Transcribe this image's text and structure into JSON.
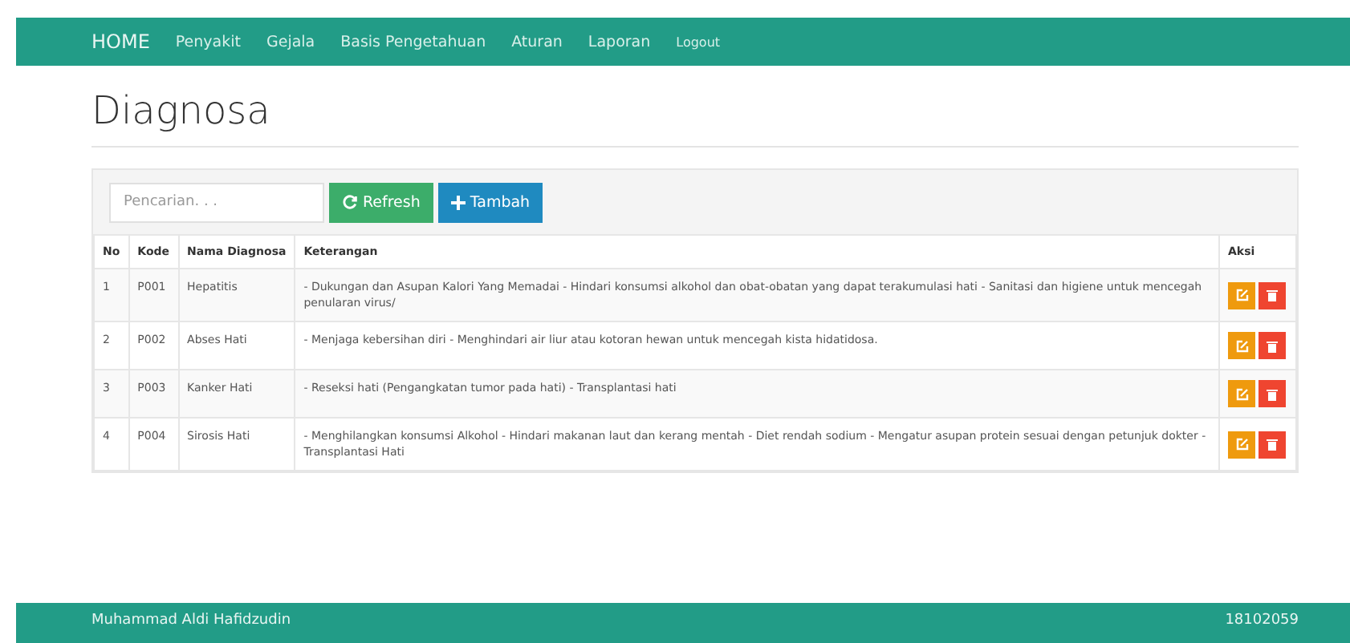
{
  "navbar": {
    "brand": "HOME",
    "items": [
      "Penyakit",
      "Gejala",
      "Basis Pengetahuan",
      "Aturan",
      "Laporan",
      "Logout"
    ]
  },
  "title": "Diagnosa",
  "toolbar": {
    "search": {
      "placeholder": "Pencarian. . ."
    },
    "refresh": "Refresh",
    "add": "Tambah"
  },
  "table": {
    "columns": [
      "No",
      "Kode",
      "Nama Diagnosa",
      "Keterangan",
      "Aksi"
    ],
    "rows": [
      {
        "no": "1",
        "kode": "P001",
        "nama": "Hepatitis",
        "keterangan": "- Dukungan dan Asupan Kalori Yang Memadai - Hindari konsumsi alkohol dan obat-obatan yang dapat terakumulasi hati - Sanitasi dan higiene untuk mencegah penularan virus/"
      },
      {
        "no": "2",
        "kode": "P002",
        "nama": "Abses Hati",
        "keterangan": "- Menjaga kebersihan diri - Menghindari air liur atau kotoran hewan untuk mencegah kista hidatidosa."
      },
      {
        "no": "3",
        "kode": "P003",
        "nama": "Kanker Hati",
        "keterangan": "- Reseksi hati (Pengangkatan tumor pada hati) - Transplantasi hati"
      },
      {
        "no": "4",
        "kode": "P004",
        "nama": "Sirosis Hati",
        "keterangan": "- Menghilangkan konsumsi Alkohol - Hindari makanan laut dan kerang mentah - Diet rendah sodium - Mengatur asupan protein sesuai dengan petunjuk dokter - Transplantasi Hati"
      }
    ]
  },
  "footer": {
    "name": "Muhammad Aldi Hafidzudin",
    "nim": "18102059"
  }
}
